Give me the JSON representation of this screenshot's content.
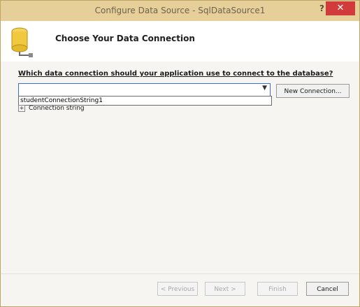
{
  "window": {
    "title": "Configure Data Source - SqlDataSource1",
    "help_label": "?",
    "close_label": "✕"
  },
  "header": {
    "icon": "database-icon",
    "heading": "Choose Your Data Connection"
  },
  "connection": {
    "question": "Which data connection should your application use to connect to the database?",
    "combo_value": "",
    "dropdown_items": [
      "studentConnectionString1"
    ],
    "new_connection_label": "New Connection...",
    "expander_label": "Connection string"
  },
  "footer": {
    "previous_label": "< Previous",
    "next_label": "Next >",
    "finish_label": "Finish",
    "cancel_label": "Cancel"
  },
  "colors": {
    "titlebar": "#e6cf98",
    "close": "#d13b3b",
    "combo_border": "#3a6fd0"
  }
}
